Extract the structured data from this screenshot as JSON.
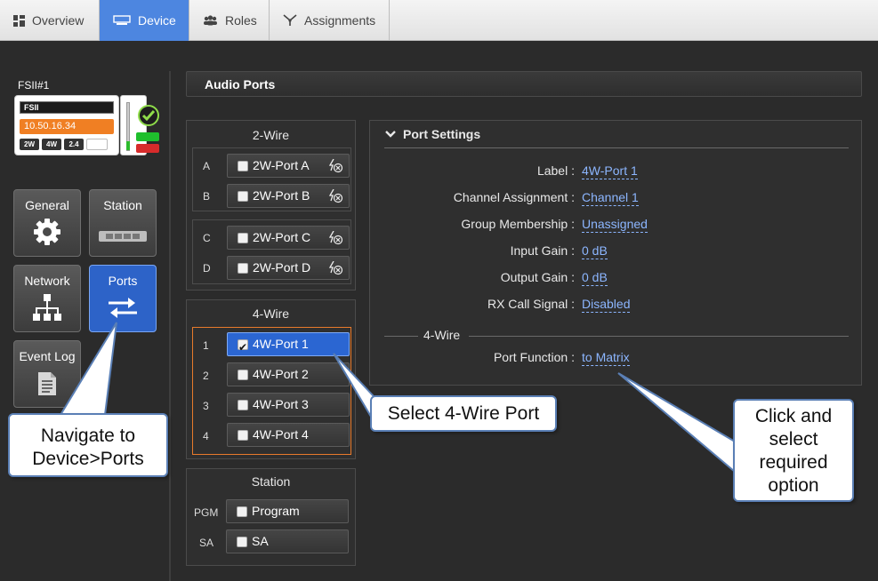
{
  "tabs": [
    {
      "label": "Overview",
      "icon": "dashboard-icon"
    },
    {
      "label": "Device",
      "icon": "device-icon",
      "active": true
    },
    {
      "label": "Roles",
      "icon": "users-icon"
    },
    {
      "label": "Assignments",
      "icon": "assignments-icon"
    }
  ],
  "device": {
    "name": "FSII#1",
    "card_title": "FSII",
    "ip": "10.50.16.34",
    "chips": [
      "2W",
      "4W",
      "2.4"
    ]
  },
  "nav": {
    "general": "General",
    "station": "Station",
    "network": "Network",
    "ports": "Ports",
    "event_log": "Event Log"
  },
  "main": {
    "section_title": "Audio Ports",
    "two_wire": {
      "title": "2-Wire",
      "ports": [
        {
          "letter": "A",
          "label": "2W-Port A"
        },
        {
          "letter": "B",
          "label": "2W-Port B"
        },
        {
          "letter": "C",
          "label": "2W-Port C"
        },
        {
          "letter": "D",
          "label": "2W-Port D"
        }
      ]
    },
    "four_wire": {
      "title": "4-Wire",
      "ports": [
        {
          "letter": "1",
          "label": "4W-Port 1",
          "checked": true
        },
        {
          "letter": "2",
          "label": "4W-Port 2"
        },
        {
          "letter": "3",
          "label": "4W-Port 3"
        },
        {
          "letter": "4",
          "label": "4W-Port 4"
        }
      ]
    },
    "station": {
      "title": "Station",
      "ports": [
        {
          "letter": "PGM",
          "label": "Program"
        },
        {
          "letter": "SA",
          "label": "SA"
        }
      ]
    }
  },
  "settings": {
    "title": "Port Settings",
    "rows": [
      {
        "label": "Label :",
        "value": "4W-Port 1"
      },
      {
        "label": "Channel Assignment :",
        "value": "Channel 1"
      },
      {
        "label": "Group Membership :",
        "value": "Unassigned"
      },
      {
        "label": "Input Gain :",
        "value": "0 dB"
      },
      {
        "label": "Output Gain :",
        "value": "0 dB"
      },
      {
        "label": "RX Call Signal :",
        "value": "Disabled"
      }
    ],
    "subsection": "4-Wire",
    "port_function": {
      "label": "Port Function :",
      "value": "to Matrix"
    }
  },
  "callouts": {
    "navigate": "Navigate to Device>Ports",
    "select": "Select 4-Wire Port",
    "click": "Click and select required option"
  },
  "colors": {
    "accent": "#2d63c8",
    "tab_active": "#4d86e0",
    "selection_border": "#e87a2b",
    "link": "#8cb6ff"
  }
}
